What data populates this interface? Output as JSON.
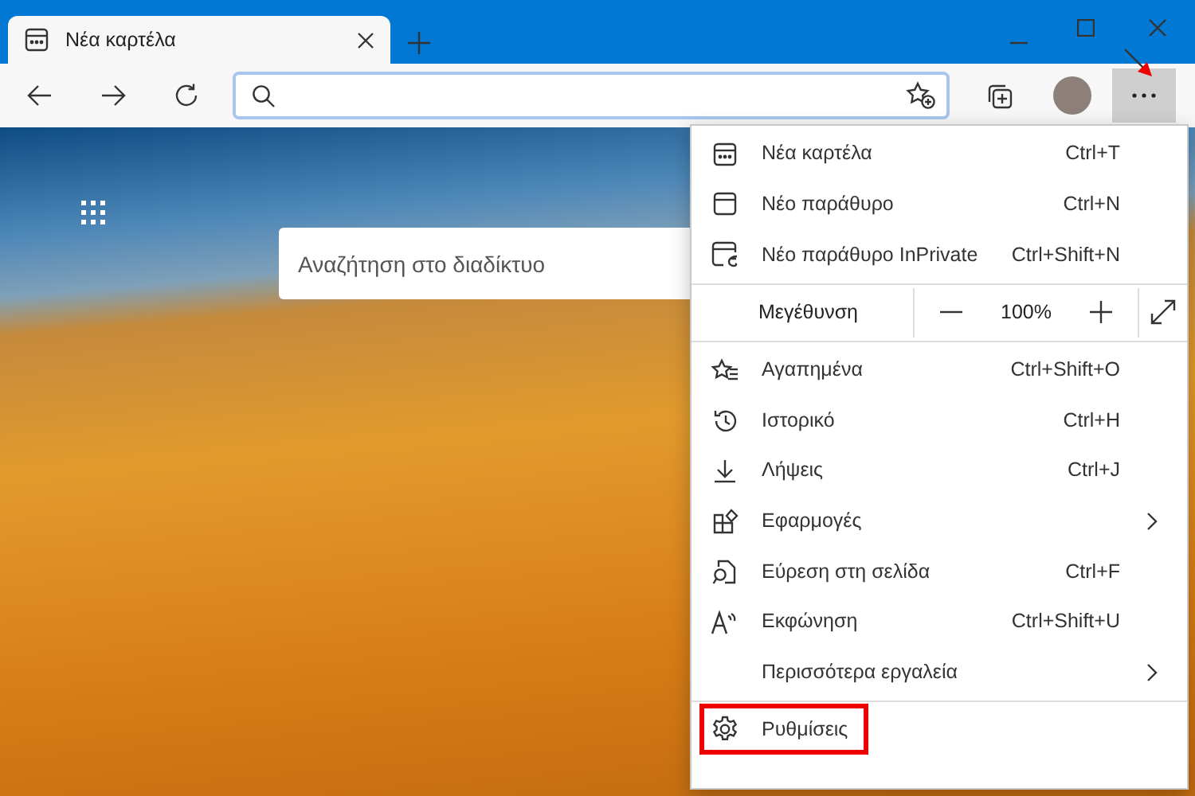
{
  "tab": {
    "title": "Νέα καρτέλα",
    "selected": true
  },
  "more_button": {
    "annotated": true
  },
  "new_tab_page": {
    "search": {
      "placeholder": "Αναζήτηση στο διαδίκτυο"
    }
  },
  "menu": {
    "items": [
      {
        "kind": "item",
        "label": "Νέα καρτέλα",
        "shortcut": "Ctrl+T",
        "submenu": false,
        "highlighted": false
      },
      {
        "kind": "item",
        "label": "Νέο παράθυρο",
        "shortcut": "Ctrl+N",
        "submenu": false,
        "highlighted": false
      },
      {
        "kind": "item",
        "label": "Νέο παράθυρο InPrivate",
        "shortcut": "Ctrl+Shift+N",
        "submenu": false,
        "highlighted": false
      },
      {
        "kind": "divider"
      },
      {
        "kind": "zoom",
        "label": "Μεγέθυνση",
        "value": "100%"
      },
      {
        "kind": "divider"
      },
      {
        "kind": "item",
        "label": "Αγαπημένα",
        "shortcut": "Ctrl+Shift+O",
        "submenu": false,
        "highlighted": false
      },
      {
        "kind": "item",
        "label": "Ιστορικό",
        "shortcut": "Ctrl+H",
        "submenu": false,
        "highlighted": false
      },
      {
        "kind": "item",
        "label": "Λήψεις",
        "shortcut": "Ctrl+J",
        "submenu": false,
        "highlighted": false
      },
      {
        "kind": "item",
        "label": "Εφαρμογές",
        "submenu": true,
        "highlighted": false
      },
      {
        "kind": "item",
        "label": "Εύρεση στη σελίδα",
        "shortcut": "Ctrl+F",
        "submenu": false,
        "highlighted": false
      },
      {
        "kind": "item",
        "label": "Εκφώνηση",
        "shortcut": "Ctrl+Shift+U",
        "submenu": false,
        "highlighted": false
      },
      {
        "kind": "item",
        "label": "Περισσότερα εργαλεία",
        "submenu": true,
        "highlighted": false
      },
      {
        "kind": "divider"
      },
      {
        "kind": "item",
        "label": "Ρυθμίσεις",
        "submenu": false,
        "highlighted": true
      }
    ]
  }
}
